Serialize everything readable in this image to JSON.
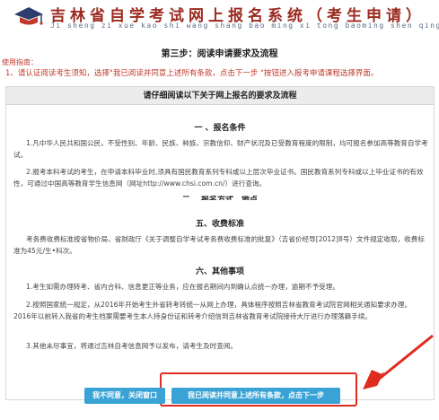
{
  "header": {
    "title": "吉林省自学考试网上报名系统（考生申请）",
    "pinyin": "Ji sheng zi xue kao shi wang shang bao ming xi tong baoming shen qing"
  },
  "page": {
    "step_title": "第三步：阅读申请要求及流程",
    "guide_label": "使用指南：",
    "guide_text": "1、请认证阅读考生须知，选择\"我已阅读并同意上述所有条款，点击下一步 \"按钮进入报考申请课程选择界面。"
  },
  "panel": {
    "heading": "请仔细阅读以下关于网上报名的要求及流程",
    "sections": {
      "s1_title": "一 、报名条件",
      "s1_p1": "1.凡中华人民共和国公民，不受性别、年龄、民族、种族、宗教信仰、财产状况及已受教育程度的限制，均可报名参加高等教育自学考试。",
      "s1_p2": "2.报考本科考试的考生，在申请本科毕业时,须具有国民教育系列专科或以上层次毕业证书。国民教育系列专科或以上毕业证书的有效性，可通过中国高等教育学生信息网（网址http://www.chsi.com.cn/）进行查询。",
      "s2_cut": "二 、报名方式、地点",
      "s5_title": "五、收费标准",
      "s5_p1": "考务费收费标准按省物价局、省财政厅《关于调整自学考试考务费收费标准的批复》（吉省价经导[2012]8号）文件规定收取，收费标准为45元/生•科次。",
      "s6_title": "六、其他事项",
      "s6_p1": "1.考生如需办理转考、省内合科、信息更正等业务，应在报名期间内到确认点统一办理，逾期不予受理。",
      "s6_p2": "2.按照国家统一规定，从2016年开始考生外省转考转统一从网上办理，具体程序按照吉林省教育考试院官网相关通知要求办理。2016年以前转入我省的考生档案需要考生本人持身份证和转考介绍信到吉林省教育考试院接待大厅进行办理落籍手续。",
      "s6_p3": "3.其他未尽事宜，将通过吉林自考信息网予以发布，请考生及时查阅。"
    }
  },
  "buttons": {
    "close_label": "我不同意，关闭窗口",
    "agree_label": "我已阅读并同意上述所有条款，点击下一步"
  },
  "colors": {
    "title_red": "#9b2a1f",
    "guide_red": "#c0392b",
    "button_blue": "#3aa3d6",
    "annotation_red": "#e02b20"
  }
}
